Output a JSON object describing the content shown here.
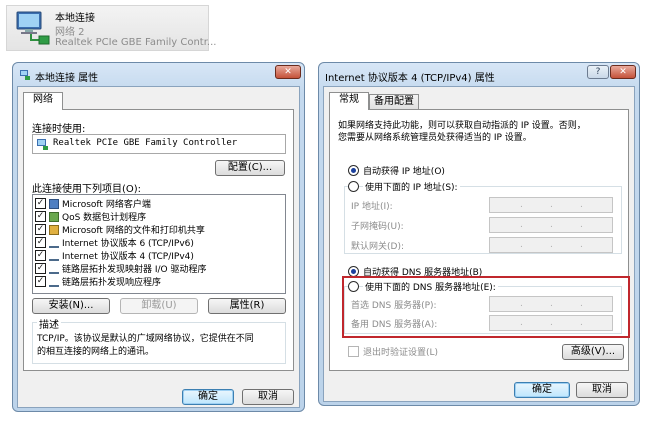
{
  "connection_header": {
    "title": "本地连接",
    "network": "网络  2",
    "adapter": "Realtek PCIe GBE Family Contr..."
  },
  "left_window": {
    "title": "本地连接 属性",
    "close_glyph": "✕",
    "tab_network": "网络",
    "connect_using_label": "连接时使用:",
    "adapter_name": "Realtek PCIe GBE Family Controller",
    "configure_button": "配置(C)...",
    "items_label": "此连接使用下列项目(O):",
    "items": [
      {
        "label": "Microsoft 网络客户端",
        "checked": true
      },
      {
        "label": "QoS 数据包计划程序",
        "checked": true
      },
      {
        "label": "Microsoft 网络的文件和打印机共享",
        "checked": true
      },
      {
        "label": "Internet 协议版本 6 (TCP/IPv6)",
        "checked": true
      },
      {
        "label": "Internet 协议版本 4 (TCP/IPv4)",
        "checked": true
      },
      {
        "label": "链路层拓扑发现映射器 I/O 驱动程序",
        "checked": true
      },
      {
        "label": "链路层拓扑发现响应程序",
        "checked": true
      }
    ],
    "install_button": "安装(N)...",
    "uninstall_button": "卸载(U)",
    "properties_button": "属性(R)",
    "description_label": "描述",
    "description_text_1": "TCP/IP。该协议是默认的广域网络协议，它提供在不同",
    "description_text_2": "的相互连接的网络上的通讯。",
    "ok_button": "确定",
    "cancel_button": "取消"
  },
  "right_window": {
    "title": "Internet 协议版本 4 (TCP/IPv4) 属性",
    "help_glyph": "?",
    "close_glyph": "✕",
    "tab_general": "常规",
    "tab_alternate": "备用配置",
    "intro_1": "如果网络支持此功能，则可以获取自动指派的 IP 设置。否则，",
    "intro_2": "您需要从网络系统管理员处获得适当的 IP 设置。",
    "auto_ip_label": "自动获得 IP 地址(O)",
    "manual_ip_label": "使用下面的 IP 地址(S):",
    "ip_address_label": "IP 地址(I):",
    "subnet_label": "子网掩码(U):",
    "gateway_label": "默认网关(D):",
    "auto_dns_label": "自动获得 DNS 服务器地址(B)",
    "manual_dns_label": "使用下面的 DNS 服务器地址(E):",
    "preferred_dns_label": "首选 DNS 服务器(P):",
    "alternate_dns_label": "备用 DNS 服务器(A):",
    "validate_label": "退出时验证设置(L)",
    "advanced_button": "高级(V)...",
    "ok_button": "确定",
    "cancel_button": "取消",
    "ip_selected": "auto",
    "dns_selected": "auto",
    "highlight_color": "#c0272d"
  }
}
